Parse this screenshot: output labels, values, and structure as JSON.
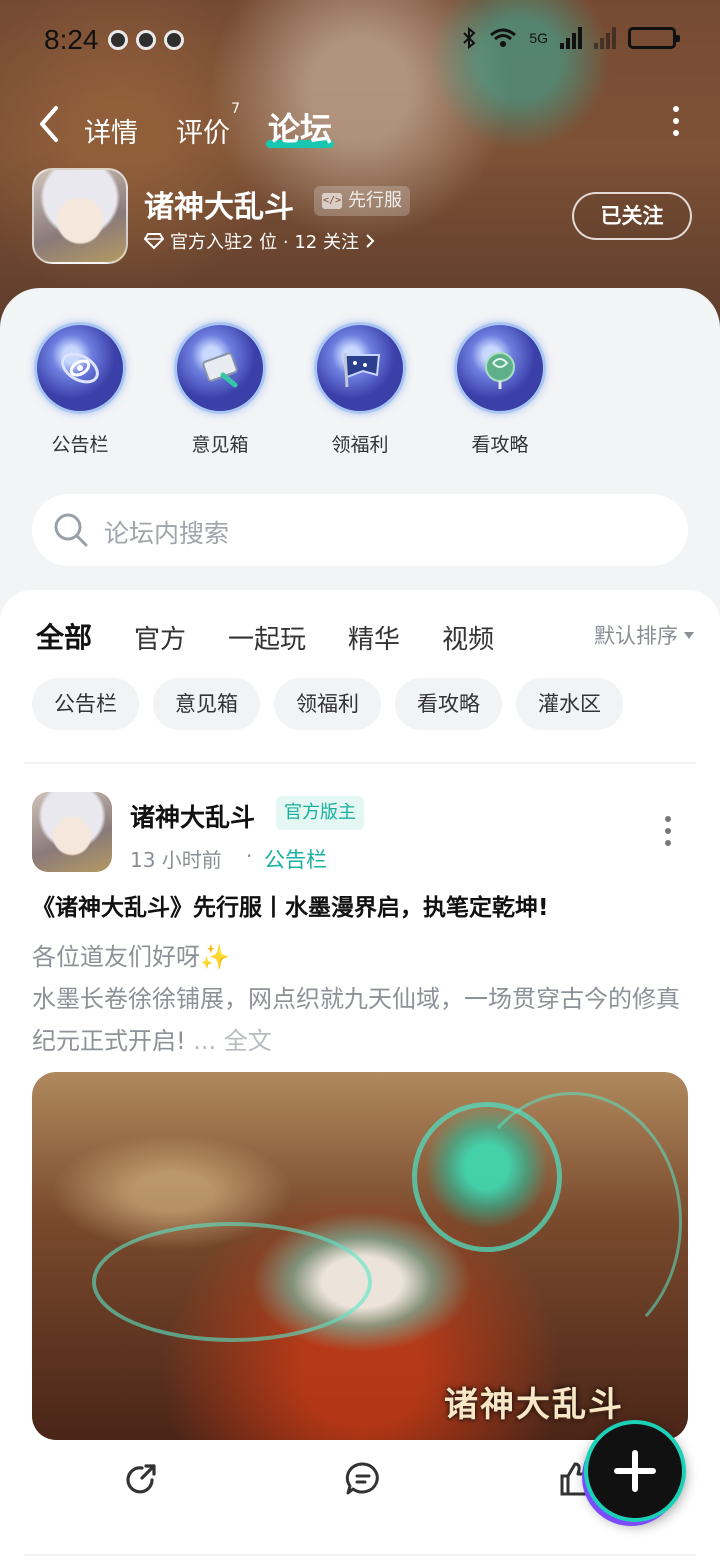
{
  "status_bar": {
    "time": "8:24",
    "network": "5G",
    "colors": {
      "icon": "#111111"
    }
  },
  "nav": {
    "tabs": [
      {
        "label": "详情"
      },
      {
        "label": "评价",
        "badge": "7"
      },
      {
        "label": "论坛"
      }
    ],
    "active_tab": "论坛",
    "accent": "#19c7b1"
  },
  "game": {
    "name": "诸神大乱斗",
    "tag": "先行服",
    "meta": "官方入驻2 位 · 12 关注",
    "follow_label": "已关注"
  },
  "quick_links": [
    {
      "label": "公告栏",
      "icon": "galaxy-orb-icon"
    },
    {
      "label": "意见箱",
      "icon": "scroll-orb-icon"
    },
    {
      "label": "领福利",
      "icon": "banner-orb-icon"
    },
    {
      "label": "看攻略",
      "icon": "jade-orb-icon"
    }
  ],
  "search": {
    "placeholder": "论坛内搜索"
  },
  "filter_tabs": [
    {
      "label": "全部"
    },
    {
      "label": "官方"
    },
    {
      "label": "一起玩"
    },
    {
      "label": "精华"
    },
    {
      "label": "视频"
    }
  ],
  "active_filter": "全部",
  "sort_label": "默认排序",
  "chips": [
    "公告栏",
    "意见箱",
    "领福利",
    "看攻略",
    "灌水区"
  ],
  "post": {
    "author": "诸神大乱斗",
    "role_tag": "官方版主",
    "time": "13 小时前",
    "separator": "·",
    "board": "公告栏",
    "title": "《诸神大乱斗》先行服丨水墨漫界启，执笔定乾坤!",
    "body_line1": "各位道友们好呀",
    "body_emoji": "✨",
    "body_line2": "水墨长卷徐徐铺展，网点织就九天仙域，一场贯穿古今的修真纪元正式开启!",
    "read_more": "... 全文",
    "image_logo_text": "诸神大乱斗"
  },
  "colors": {
    "accent": "#19c7b1",
    "official_tag_bg": "#e4f7f3",
    "sheet_bg": "#f3f4f6"
  }
}
